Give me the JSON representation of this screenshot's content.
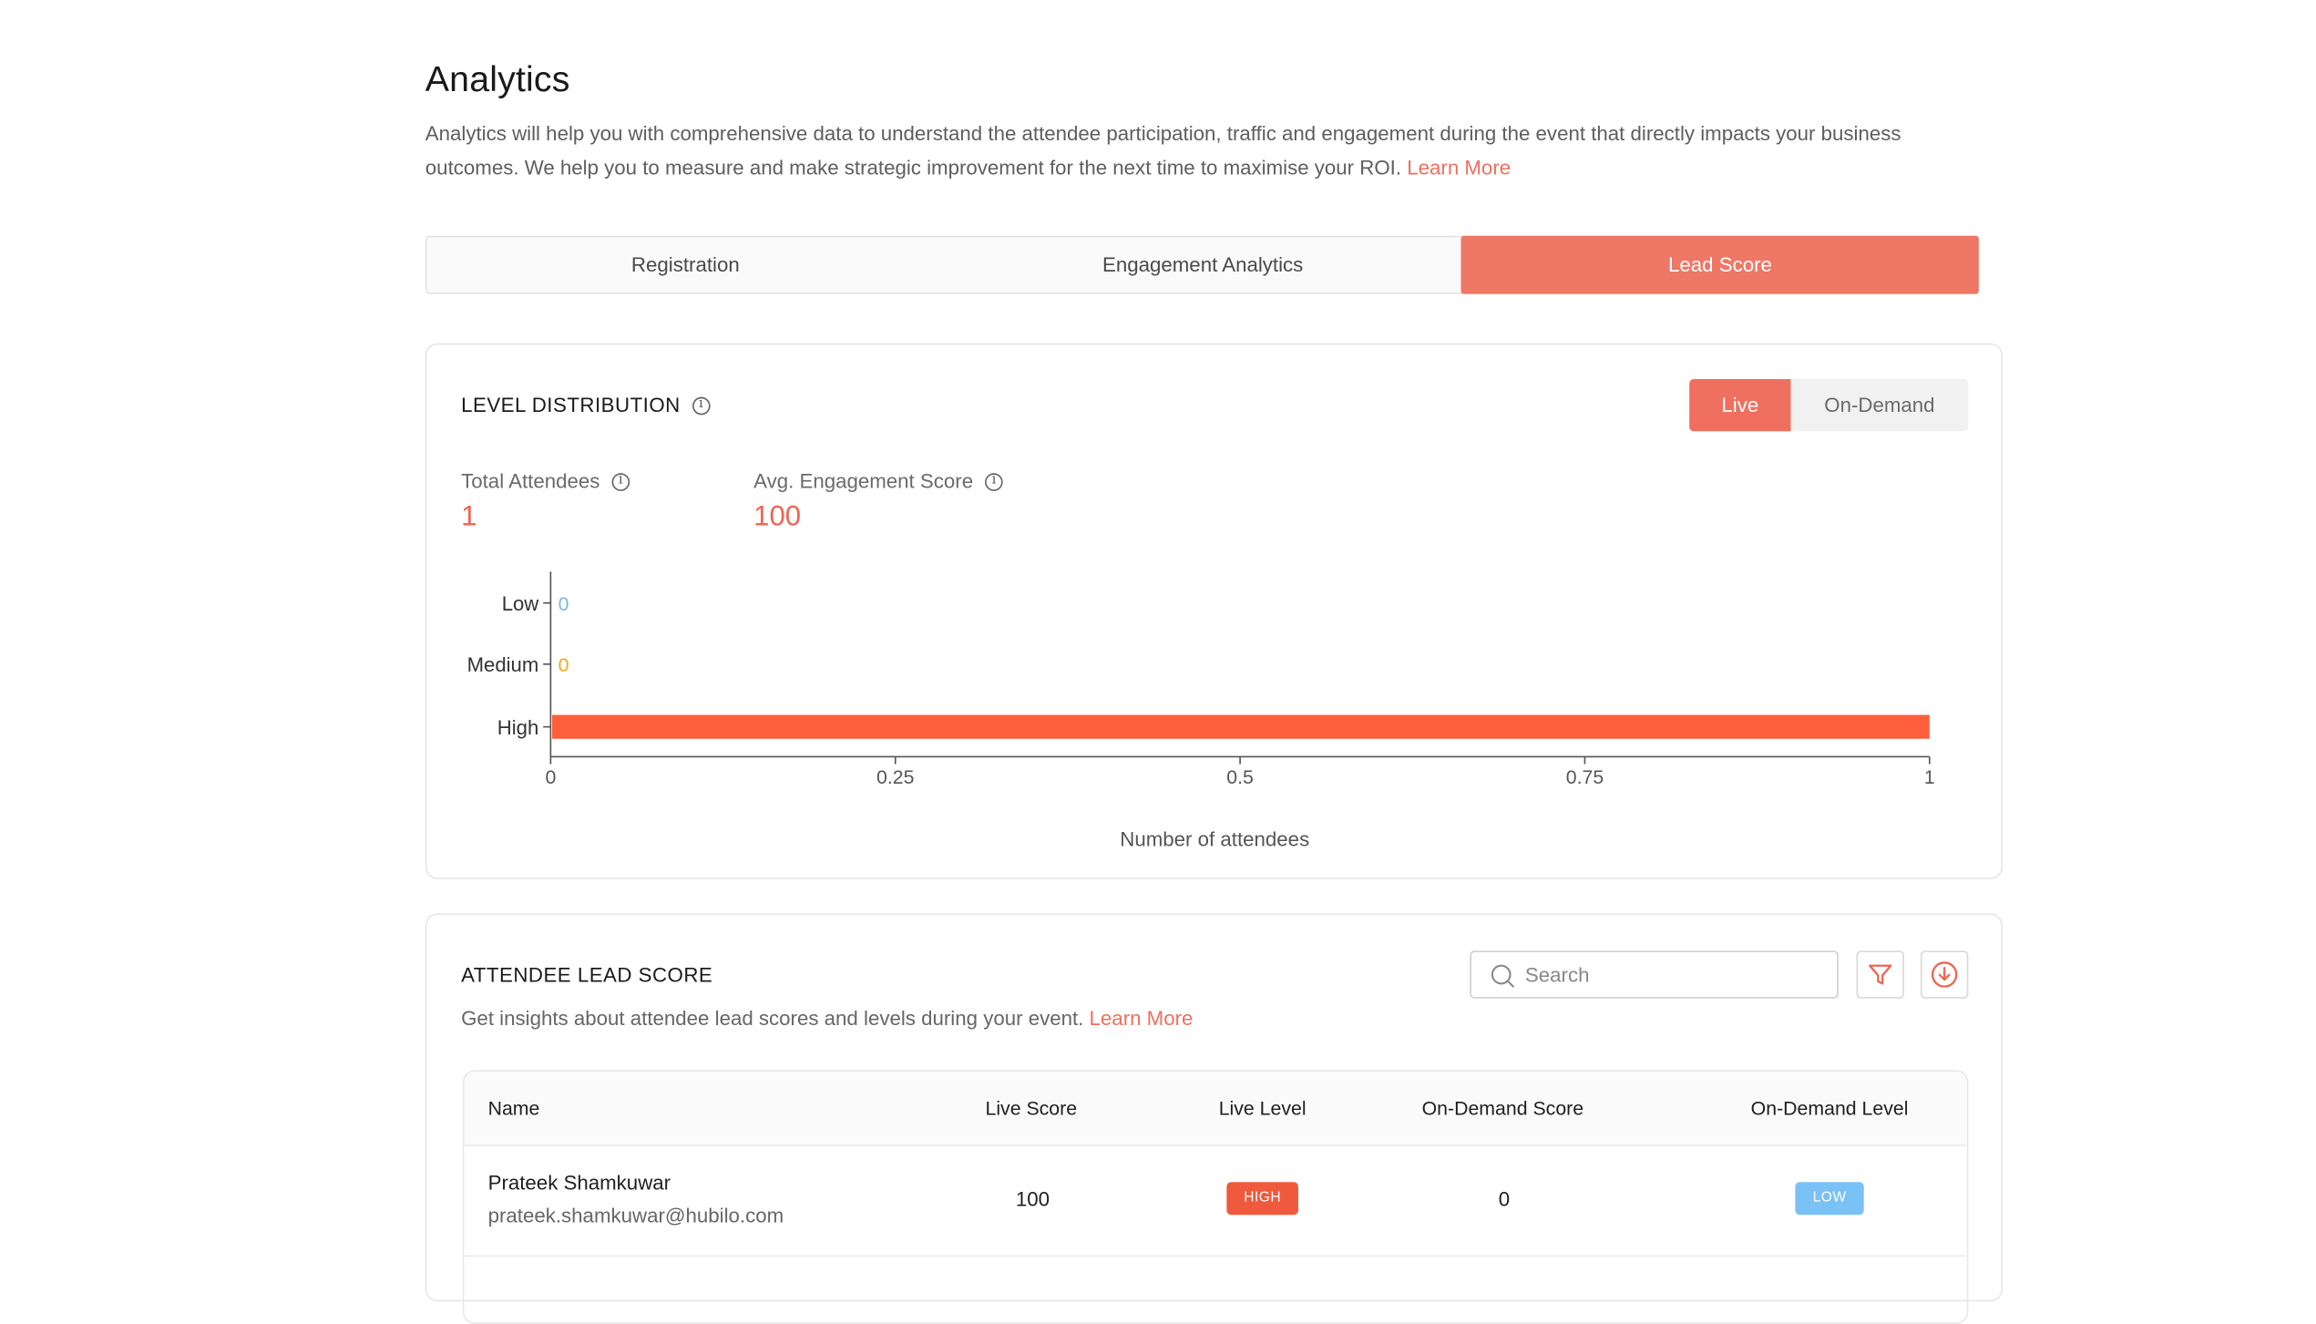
{
  "header": {
    "title": "Analytics",
    "description": "Analytics will help you with comprehensive data to understand the attendee participation, traffic and engagement during the event that directly impacts your business outcomes. We help you to measure and make strategic improvement for the next time to maximise your ROI.",
    "learn_more": "Learn More"
  },
  "tabs": [
    {
      "label": "Registration",
      "active": false
    },
    {
      "label": "Engagement Analytics",
      "active": false
    },
    {
      "label": "Lead Score",
      "active": true
    }
  ],
  "level_distribution": {
    "title": "LEVEL DISTRIBUTION",
    "toggle": {
      "live": "Live",
      "on_demand": "On-Demand",
      "selected": "Live"
    },
    "stats": [
      {
        "label": "Total Attendees",
        "value": "1"
      },
      {
        "label": "Avg. Engagement Score",
        "value": "100"
      }
    ]
  },
  "chart_data": {
    "type": "bar",
    "orientation": "horizontal",
    "categories": [
      "Low",
      "Medium",
      "High"
    ],
    "values": [
      0,
      0,
      1
    ],
    "value_labels": [
      "0",
      "0",
      ""
    ],
    "colors": {
      "Low": "#7ab8e6",
      "Medium": "#f5a623",
      "High": "#ff5f3d"
    },
    "xlabel": "Number of attendees",
    "ylabel": "",
    "xlim": [
      0,
      1
    ],
    "xticks": [
      "0",
      "0.25",
      "0.5",
      "0.75",
      "1"
    ],
    "grid": false
  },
  "lead_score": {
    "title": "ATTENDEE LEAD SCORE",
    "subtitle": "Get insights about attendee lead scores and levels during your event.",
    "learn_more": "Learn More",
    "search_placeholder": "Search",
    "icons": {
      "search": "search-icon",
      "filter": "filter-icon",
      "download": "download-icon"
    },
    "columns": [
      "Name",
      "Live Score",
      "Live Level",
      "On-Demand Score",
      "On-Demand Level"
    ],
    "rows": [
      {
        "name": "Prateek Shamkuwar",
        "email": "prateek.shamkuwar@hubilo.com",
        "live_score": "100",
        "live_level": "HIGH",
        "on_demand_score": "0",
        "on_demand_level": "LOW"
      }
    ]
  },
  "colors": {
    "accent": "#ef6f5e",
    "high": "#f05a3c",
    "low": "#7ac1f5"
  }
}
